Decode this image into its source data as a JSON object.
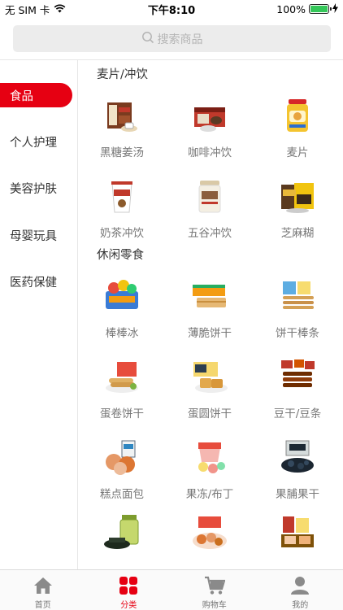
{
  "status": {
    "carrier": "无 SIM 卡",
    "time": "下午8:10",
    "battery_percent": "100%",
    "battery_level": 1.0
  },
  "search": {
    "placeholder": "搜索商品"
  },
  "sidebar": {
    "items": [
      {
        "label": "食品",
        "active": true
      },
      {
        "label": "个人护理",
        "active": false
      },
      {
        "label": "美容护肤",
        "active": false
      },
      {
        "label": "母婴玩具",
        "active": false
      },
      {
        "label": "医药保健",
        "active": false
      }
    ]
  },
  "sections": [
    {
      "title": "麦片/冲饮",
      "products": [
        {
          "label": "黑糖姜汤",
          "icon": "ginger-tea-box-icon"
        },
        {
          "label": "咖啡冲饮",
          "icon": "coffee-box-icon"
        },
        {
          "label": "麦片",
          "icon": "cereal-jar-icon"
        },
        {
          "label": "奶茶冲饮",
          "icon": "milk-tea-cup-icon"
        },
        {
          "label": "五谷冲饮",
          "icon": "grain-jar-icon"
        },
        {
          "label": "芝麻糊",
          "icon": "sesame-paste-icon"
        }
      ]
    },
    {
      "title": "休闲零食",
      "products": [
        {
          "label": "棒棒冰",
          "icon": "ice-pop-icon"
        },
        {
          "label": "薄脆饼干",
          "icon": "crisp-biscuit-icon"
        },
        {
          "label": "饼干棒条",
          "icon": "biscuit-stick-icon"
        },
        {
          "label": "蛋卷饼干",
          "icon": "egg-roll-icon"
        },
        {
          "label": "蛋圆饼干",
          "icon": "waffle-biscuit-icon"
        },
        {
          "label": "豆干/豆条",
          "icon": "dried-tofu-icon"
        },
        {
          "label": "糕点面包",
          "icon": "bread-icon"
        },
        {
          "label": "果冻/布丁",
          "icon": "jelly-icon"
        },
        {
          "label": "果脯果干",
          "icon": "dried-fruit-icon"
        },
        {
          "label": "",
          "icon": "seaweed-jar-icon"
        },
        {
          "label": "",
          "icon": "cookie-plate-icon"
        },
        {
          "label": "",
          "icon": "cake-bar-icon"
        }
      ]
    }
  ],
  "tabbar": {
    "tabs": [
      {
        "label": "首页",
        "icon": "home-icon",
        "active": false
      },
      {
        "label": "分类",
        "icon": "category-grid-icon",
        "active": true
      },
      {
        "label": "购物车",
        "icon": "cart-icon",
        "active": false
      },
      {
        "label": "我的",
        "icon": "user-icon",
        "active": false
      }
    ]
  },
  "colors": {
    "accent": "#e60012",
    "muted_text": "#777777",
    "search_bg": "#ececec"
  }
}
